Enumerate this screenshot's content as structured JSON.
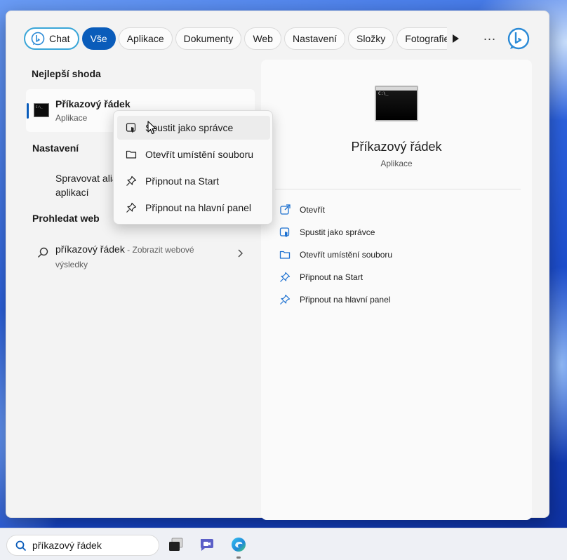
{
  "filters": {
    "chat": "Chat",
    "items": [
      "Vše",
      "Aplikace",
      "Dokumenty",
      "Web",
      "Nastavení",
      "Složky",
      "Fotografie"
    ],
    "active": "Vše",
    "more": "..."
  },
  "left": {
    "best_match_title": "Nejlepší shoda",
    "best_match": {
      "name": "Příkazový řádek",
      "type": "Aplikace"
    },
    "settings_title": "Nastavení",
    "settings_item": "Spravovat aliasy pro spouštění aplikací",
    "settings_item_line1": "Spravovat alia",
    "settings_item_line2": "aplikací",
    "web_title": "Prohledat web",
    "web_item": {
      "query": "příkazový řádek",
      "suffix": " - Zobrazit webové výsledky"
    }
  },
  "context_menu": {
    "items": [
      {
        "label": "Spustit jako správce",
        "icon": "shield-icon"
      },
      {
        "label": "Otevřít umístění souboru",
        "icon": "folder-icon"
      },
      {
        "label": "Připnout na Start",
        "icon": "pin-icon"
      },
      {
        "label": "Připnout na hlavní panel",
        "icon": "pin-icon"
      }
    ]
  },
  "detail": {
    "name": "Příkazový řádek",
    "type": "Aplikace",
    "actions": [
      {
        "label": "Otevřít",
        "icon": "open-external-icon"
      },
      {
        "label": "Spustit jako správce",
        "icon": "shield-icon"
      },
      {
        "label": "Otevřít umístění souboru",
        "icon": "folder-icon"
      },
      {
        "label": "Připnout na Start",
        "icon": "pin-icon"
      },
      {
        "label": "Připnout na hlavní panel",
        "icon": "pin-icon"
      }
    ]
  },
  "taskbar": {
    "search_value": "příkazový řádek"
  },
  "colors": {
    "accent": "#0a5cba",
    "chat_border": "#3aa6d8"
  }
}
